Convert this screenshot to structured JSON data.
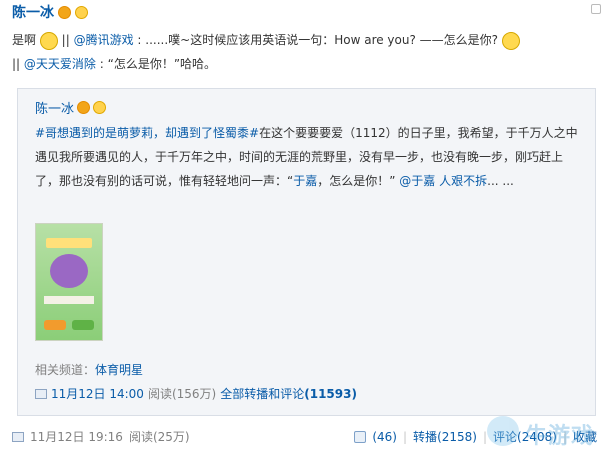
{
  "post": {
    "author": "陈一冰",
    "text_1": "是啊",
    "text_2": " || ",
    "mention_1": "@腾讯游戏",
    "text_3": ": ......噗~这时候应该用英语说一句：How are you? ——怎么是你?",
    "text_4": "|| ",
    "mention_2": "@天天爱消除",
    "text_5": ": “怎么是你！”哈哈。"
  },
  "quote": {
    "author": "陈一冰",
    "hashtag": "#哥想遇到的是萌萝莉，却遇到了怪蜀黍#",
    "body_1": "在这个要要要爱（1112）的日子里，我希望，于千万人之中遇见我所要遇见的人，于千万年之中，时间的无涯的荒野里，没有早一步，也没有晚一步，刚巧赶上了，那也没有别的话可说，惟有轻轻地问一声：“",
    "link_yujia": "于嘉",
    "body_2": "，怎么是你！”",
    "mention_yujia": "@于嘉",
    "link_more": "人艰不拆",
    "ellipsis": "... ...",
    "channel_label": "相关频道：",
    "channel_link": "体育明星",
    "date": "11月12日 14:00",
    "read_count": "阅读(156万)",
    "all_link": "全部转播和评论",
    "all_count": "(11593)"
  },
  "footer": {
    "date": "11月12日 19:16",
    "read_count": "阅读(25万)",
    "like_count": "(46)",
    "sep": "|",
    "repost_label": "转播",
    "repost_count": "(2158)",
    "comment_label": "评论",
    "comment_count": "(2408)",
    "favorite_label": "收藏"
  },
  "watermark": {
    "text": "牛游戏"
  },
  "colors": {
    "link": "#0a5ca8",
    "muted": "#808080",
    "quote_bg": "#f3f5f8"
  }
}
